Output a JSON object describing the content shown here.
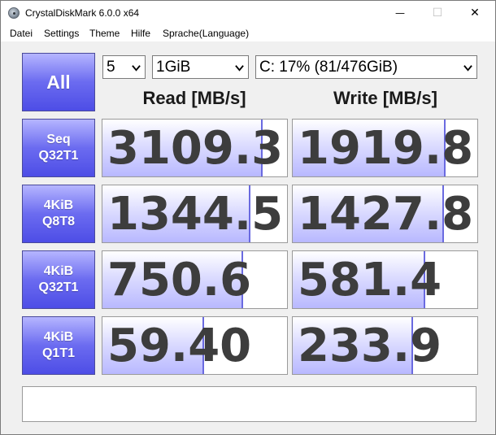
{
  "window": {
    "title": "CrystalDiskMark 6.0.0 x64",
    "minimize_glyph": "—",
    "maximize_glyph": "☐",
    "close_glyph": "✕"
  },
  "menu": {
    "items": [
      "Datei",
      "Settings",
      "Theme",
      "Hilfe",
      "Sprache(Language)"
    ]
  },
  "controls": {
    "all_label": "All",
    "count_value": "5",
    "size_value": "1GiB",
    "drive_value": "C: 17% (81/476GiB)"
  },
  "headers": {
    "read": "Read [MB/s]",
    "write": "Write [MB/s]"
  },
  "rows": [
    {
      "line1": "Seq",
      "line2": "Q32T1",
      "read": "3109.3",
      "write": "1919.8",
      "read_fill": 0.87,
      "write_fill": 0.83
    },
    {
      "line1": "4KiB",
      "line2": "Q8T8",
      "read": "1344.5",
      "write": "1427.8",
      "read_fill": 0.8,
      "write_fill": 0.82
    },
    {
      "line1": "4KiB",
      "line2": "Q32T1",
      "read": "750.6",
      "write": "581.4",
      "read_fill": 0.76,
      "write_fill": 0.72
    },
    {
      "line1": "4KiB",
      "line2": "Q1T1",
      "read": "59.40",
      "write": "233.9",
      "read_fill": 0.55,
      "write_fill": 0.65
    }
  ],
  "status": {
    "text": ""
  },
  "colors": {
    "button_top": "#b5b5ff",
    "button_bottom": "#4d4de6",
    "bar_fill": "#b8b8ff",
    "value_text": "#3d3d3d"
  }
}
